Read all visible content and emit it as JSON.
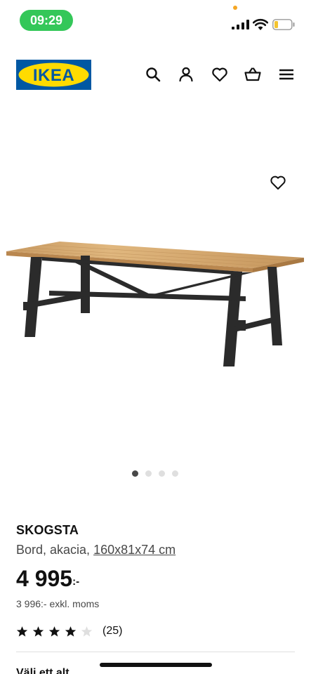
{
  "status_bar": {
    "time": "09:29",
    "icons": [
      "cellular-signal-icon",
      "wifi-icon",
      "battery-icon"
    ]
  },
  "header": {
    "logo_text": "IKEA",
    "logo_colors": {
      "background": "#0058A3",
      "oval": "#FFDB00",
      "text": "#0058A3"
    },
    "icons": [
      "search-icon",
      "user-icon",
      "heart-icon",
      "basket-icon",
      "menu-icon"
    ]
  },
  "product_image": {
    "alt": "SKOGSTA",
    "carousel": {
      "total": 4,
      "active": 1
    }
  },
  "product": {
    "name": "SKOGSTA",
    "description": "Bord, akacia, ",
    "dimensions": "160x81x74 cm",
    "price": "4 995",
    "price_suffix": ":-",
    "price_excl_vat": "3 996:- exkl. moms",
    "rating": 4,
    "rating_max": 5,
    "review_count": "(25)"
  },
  "next_section_label": "Välj ett alt..."
}
